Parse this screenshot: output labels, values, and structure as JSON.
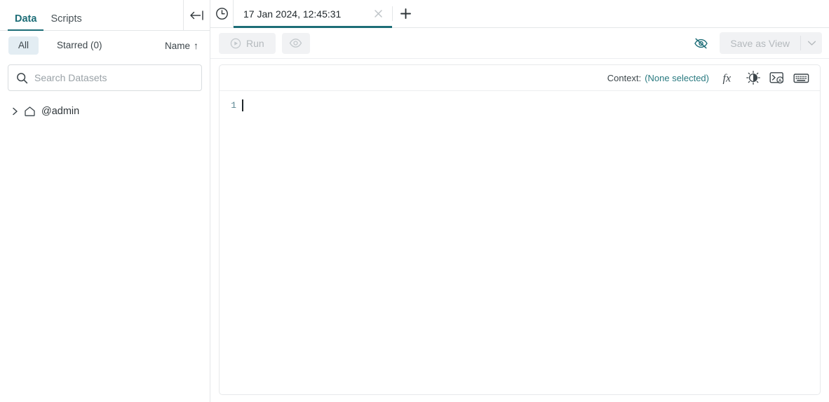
{
  "sidebar": {
    "tabs": [
      {
        "label": "Data",
        "active": true
      },
      {
        "label": "Scripts",
        "active": false
      }
    ],
    "collapse_icon": "collapse-left-icon",
    "filters": [
      {
        "label": "All",
        "active": true
      },
      {
        "label": "Starred (0)",
        "active": false
      }
    ],
    "sort": {
      "label": "Name",
      "direction": "↑"
    },
    "search": {
      "value": "",
      "placeholder": "Search Datasets",
      "icon": "search-icon"
    },
    "tree": [
      {
        "label": "@admin",
        "chevron": "›",
        "icon": "home-icon",
        "expanded": false
      }
    ]
  },
  "tabbar": {
    "clock_icon": "clock-icon",
    "tabs": [
      {
        "label": "17 Jan 2024, 12:45:31",
        "active": true,
        "close_icon": "close-icon"
      }
    ],
    "add_label": "+"
  },
  "toolbar": {
    "run_label": "Run",
    "run_icon": "play-circle-icon",
    "preview_icon": "eye-icon",
    "hide_icon": "eye-off-icon",
    "save_label": "Save as View",
    "save_caret": "chevron-down-icon"
  },
  "editor": {
    "context_label": "Context:",
    "context_value": "(None selected)",
    "icons": [
      {
        "name": "fx-icon",
        "glyph": "fx"
      },
      {
        "name": "brightness-icon",
        "glyph": "sun"
      },
      {
        "name": "console-assist-icon",
        "glyph": "terminal"
      },
      {
        "name": "keyboard-shortcuts-icon",
        "glyph": "keyboard"
      }
    ],
    "lines": [
      {
        "number": "1",
        "text": ""
      }
    ]
  },
  "colors": {
    "accent": "#1d6d77",
    "accent_link": "#2a7a80",
    "chip_active_bg": "#e3edf3",
    "disabled_bg": "#f1f2f4",
    "disabled_text": "#b4b9bd",
    "border": "#e4e6e8",
    "gutter_text": "#5b8793"
  }
}
